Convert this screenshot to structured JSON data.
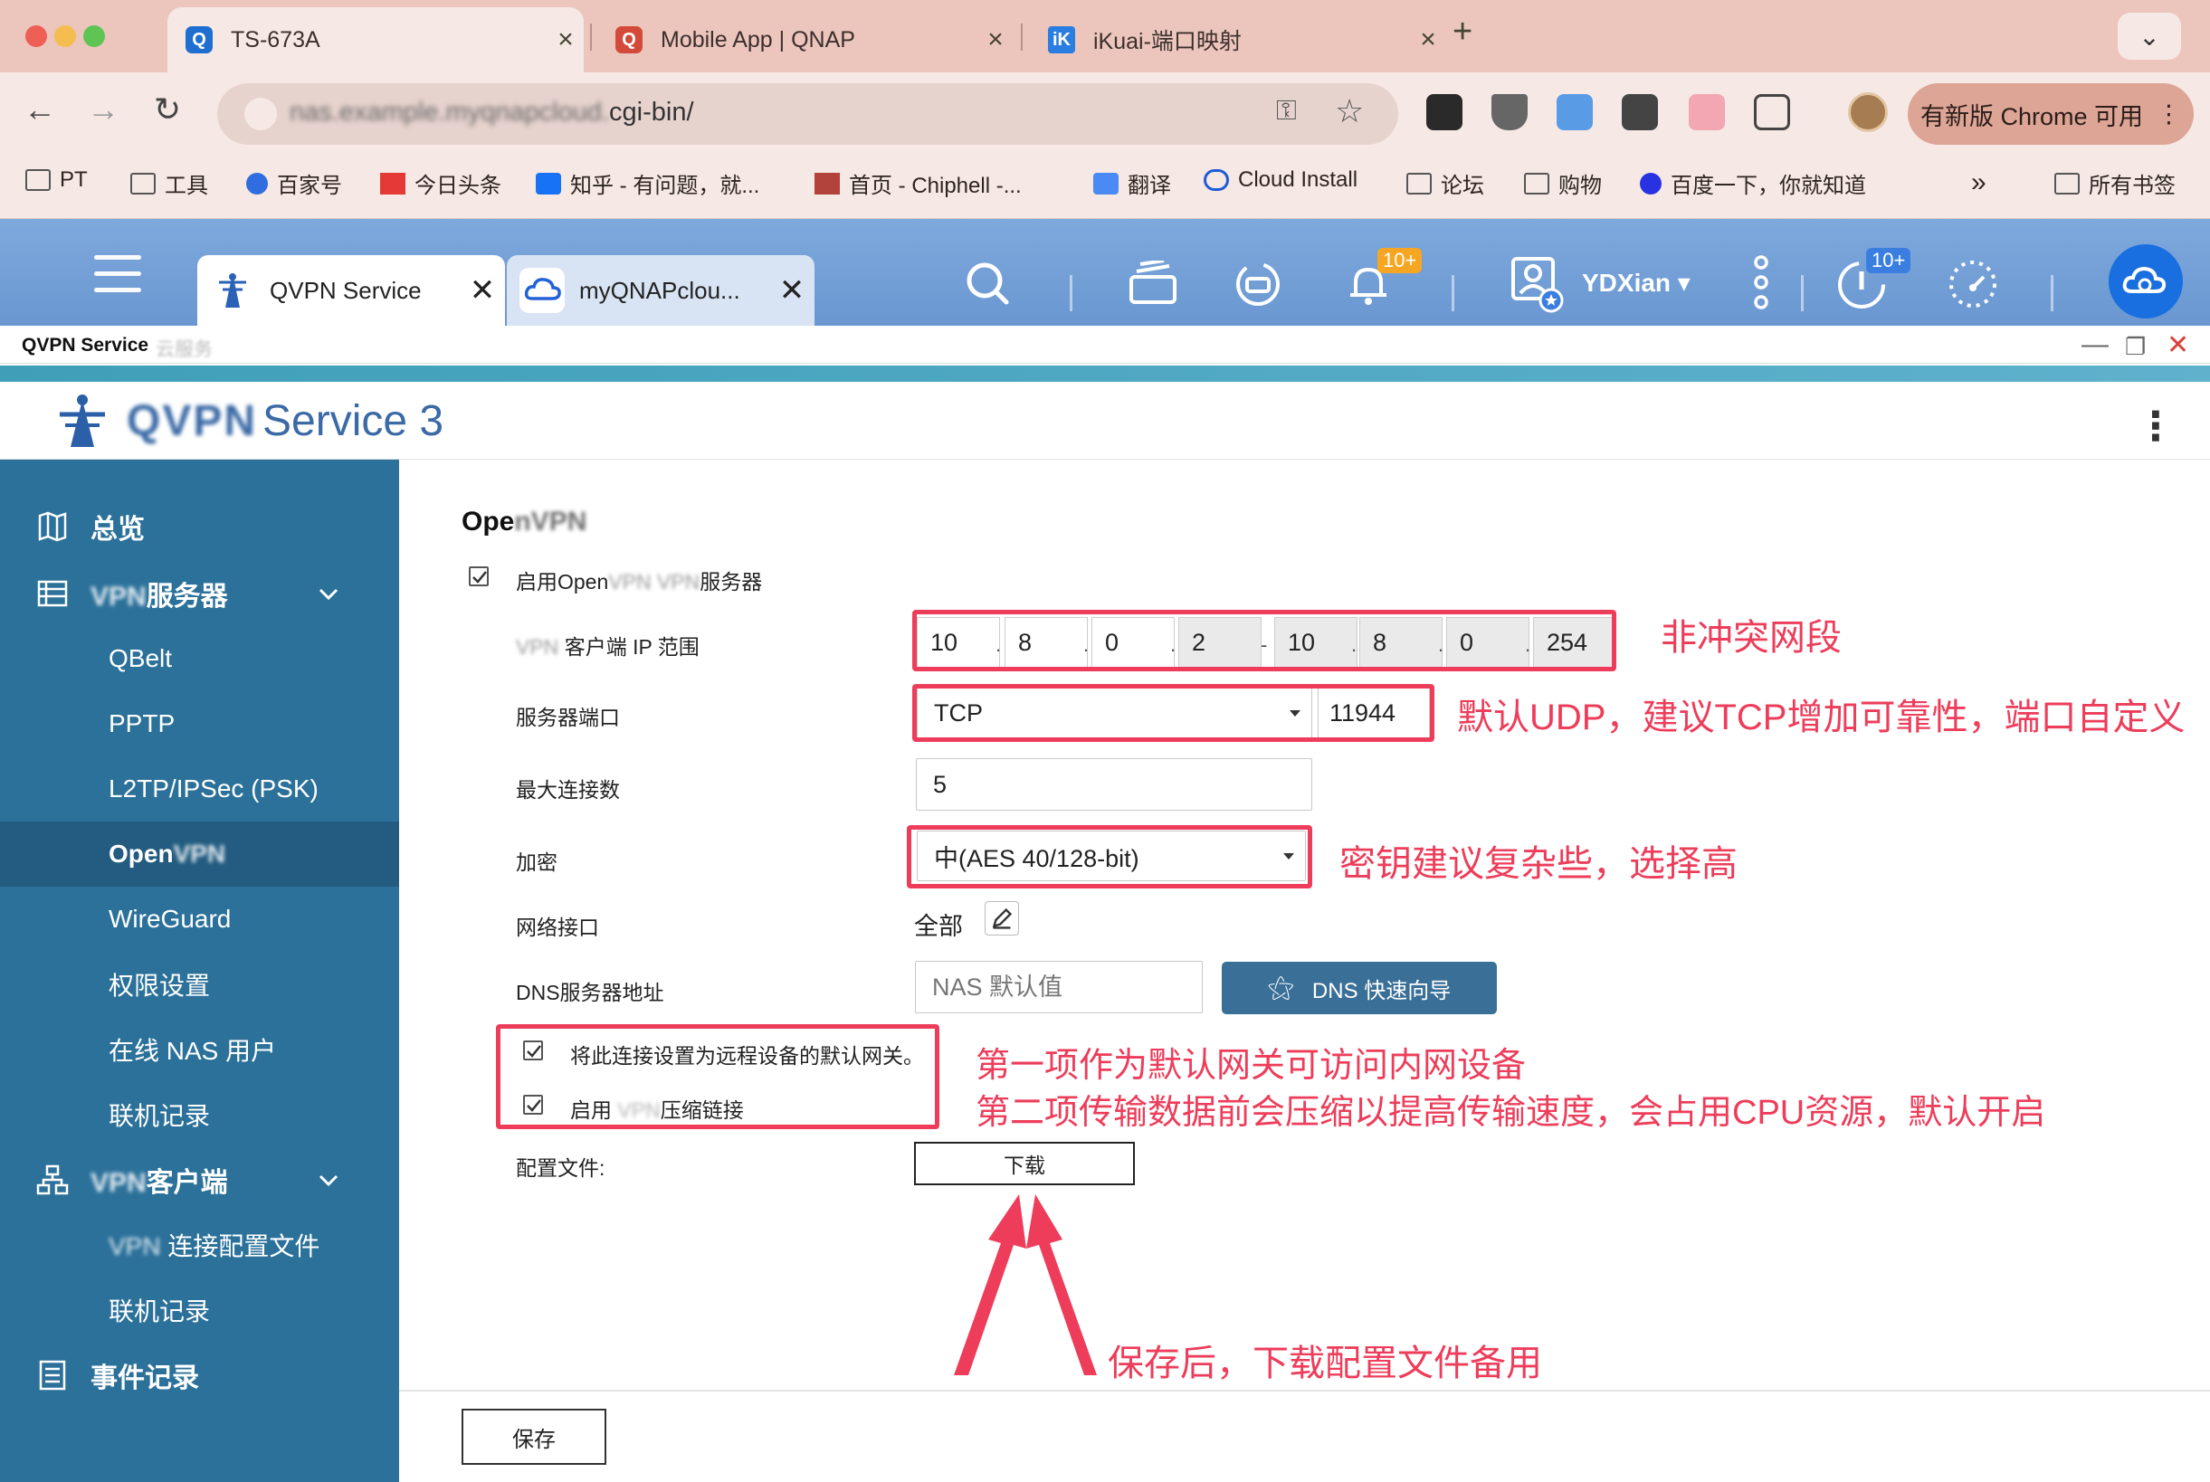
{
  "browser": {
    "tabs": [
      {
        "label": "TS-673A"
      },
      {
        "label": "Mobile App | QNAP"
      },
      {
        "label": "iKuai-端口映射"
      }
    ],
    "url_visible": "cgi-bin/",
    "url_blurred": "nas.example.myqnapcloud.",
    "update_label": "有新版 Chrome 可用",
    "bookmarks": [
      "PT",
      "工具",
      "百家号",
      "今日头条",
      "知乎 - 有问题，就...",
      "首页 - Chiphell -...",
      "翻译",
      "Cloud Install",
      "论坛",
      "购物",
      "百度一下，你就知道"
    ],
    "all_bookmarks": "所有书签"
  },
  "qnap_bar": {
    "tabs": [
      {
        "label": "QVPN Service"
      },
      {
        "label": "myQNAPclou..."
      }
    ],
    "notify_badge": "10+",
    "resource_badge": "10+",
    "username": "YDXian"
  },
  "window": {
    "title": "QVPN Service",
    "subtitle": "云服务"
  },
  "app": {
    "title_blur": "QVPN",
    "title_rest": "Service 3"
  },
  "sidebar": {
    "overview": "总览",
    "vpn_server_prefix": "VPN",
    "vpn_server": "服务器",
    "server_items": [
      "QBelt",
      "PPTP",
      "L2TP/IPSec (PSK)",
      "WireGuard",
      "权限设置",
      "在线 NAS 用户",
      "联机记录"
    ],
    "openvpn_prefix": "Open",
    "openvpn_blur": "VPN",
    "vpn_client_prefix": "VPN",
    "vpn_client": "客户端",
    "client_profile_prefix": "VPN",
    "client_profile": "连接配置文件",
    "client_log": "联机记录",
    "event_log": "事件记录"
  },
  "form": {
    "section_prefix": "Ope",
    "section_blur": "nVPN",
    "enable_prefix": "启用Open",
    "enable_blur": "VPN VPN",
    "enable_suffix": "服务器",
    "ip_range_blur": "VPN",
    "ip_range_label": "客户端 IP 范围",
    "ip_start": [
      "10",
      "8",
      "0",
      "2"
    ],
    "ip_end": [
      "10",
      "8",
      "0",
      "254"
    ],
    "port_label": "服务器端口",
    "protocol": "TCP",
    "port": "11944",
    "max_conn_label": "最大连接数",
    "max_conn": "5",
    "encryption_label": "加密",
    "encryption": "中(AES 40/128-bit)",
    "network_label": "网络接口",
    "network_value": "全部",
    "dns_label": "DNS服务器地址",
    "dns_placeholder": "NAS 默认值",
    "dns_wizard": "DNS 快速向导",
    "gateway_label": "将此连接设置为远程设备的默认网关。",
    "compress_prefix": "启用",
    "compress_blur": "VPN",
    "compress_suffix": "压缩链接",
    "config_label": "配置文件:",
    "download": "下载",
    "save": "保存"
  },
  "annotations": {
    "ip": "非冲突网段",
    "port": "默认UDP，建议TCP增加可靠性，端口自定义",
    "encryption": "密钥建议复杂些，选择高",
    "gateway_line1": "第一项作为默认网关可访问内网设备",
    "gateway_line2": "第二项传输数据前会压缩以提高传输速度，会占用CPU资源，默认开启",
    "download": "保存后，下载配置文件备用"
  },
  "colors": {
    "annotation_red": "#ed3d5a",
    "sidebar_bg": "#2c719a",
    "sidebar_selected": "#235c80",
    "qnap_bar": "#6a97d1",
    "dns_button": "#3a6f97"
  }
}
